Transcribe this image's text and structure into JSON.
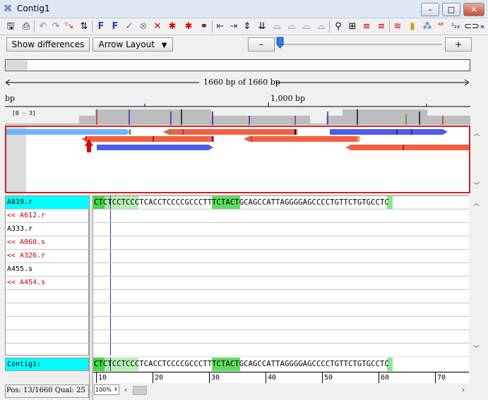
{
  "window": {
    "title": "Contig1",
    "minimize": "–",
    "maximize": "□",
    "close": "✕"
  },
  "toolbar": {
    "icons": [
      "save-icon",
      "print-icon",
      "undo-icon",
      "redo-icon",
      "trim-icon",
      "sort-icon",
      "find-forward-icon",
      "find-reverse-icon",
      "accept-icon",
      "reject-icon",
      "mark-icon",
      "star-icon",
      "star2-icon",
      "binoculars-icon",
      "move-left-icon",
      "move-right-icon",
      "compress-icon",
      "expand-icon",
      "shift-icon",
      "shift2-icon",
      "shift3-icon",
      "shift4-icon",
      "zoom-icon",
      "layout-icon",
      "flag-icon",
      "flag2-icon",
      "chromatogram-icon",
      "bars-icon",
      "translate-icon",
      "abc-icon",
      "count-icon",
      "link-icon"
    ]
  },
  "controls": {
    "show_differences": "Show differences",
    "arrow_layout": "Arrow Layout",
    "minus": "–",
    "plus": "+"
  },
  "overview": {
    "length_text": "1660 bp of 1660 bp",
    "ruler_left": "bp",
    "ruler_mid": "1,000 bp",
    "coverage_label": "[0 - 3]"
  },
  "reads": {
    "names": [
      {
        "label": "A819.r",
        "style": "selected"
      },
      {
        "label": "<< A612.r",
        "style": "reverse"
      },
      {
        "label": "A333.r",
        "style": "forward"
      },
      {
        "label": "<< A060.s",
        "style": "reverse"
      },
      {
        "label": "<< A326.r",
        "style": "reverse"
      },
      {
        "label": "A455.s",
        "style": "forward"
      },
      {
        "label": "<< A454.s",
        "style": "reverse"
      }
    ],
    "sequence": "CTCTCCTCCCTCACCTCCCCGCCCTTTCTACTGCAGCCATTAGGGGAGCCCCTGTTCTGTGCCTC"
  },
  "consensus": {
    "label": "Contig1:",
    "sequence": "CTCTCCTCCCTCACCTCCCCGCCCTTTCTACTGCAGCCATTAGGGGAGCCCCTGTTCTGTGCCTC"
  },
  "ruler": {
    "ticks": [
      "10",
      "20",
      "30",
      "40",
      "50",
      "60",
      "70"
    ]
  },
  "status": {
    "position": "Pos: 13/1660  Qual: 25 (",
    "zoom": "100%"
  },
  "colors": {
    "forward": "#4b5ee8",
    "reverse": "#f35f3f",
    "light_forward": "#6fb4ff",
    "selected_name_bg": "#00ffff",
    "frame_border": "#d42020",
    "highlight_green": "#5fdc5f"
  }
}
